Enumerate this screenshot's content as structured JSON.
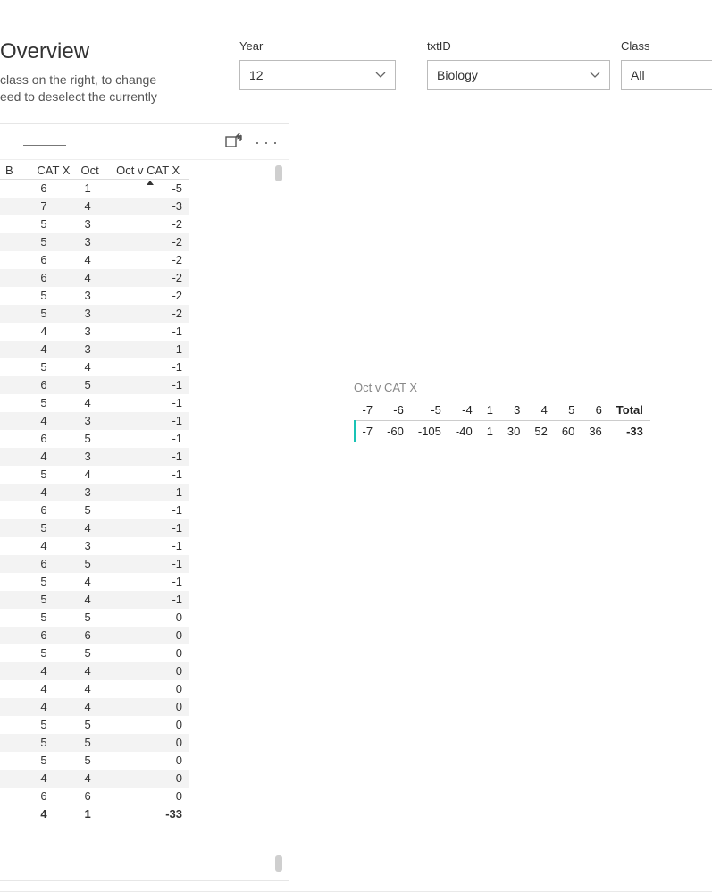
{
  "header": {
    "title": "Overview",
    "subtitle_line1": "class on the right, to change",
    "subtitle_line2": "eed to deselect the currently"
  },
  "slicers": {
    "year": {
      "label": "Year",
      "value": "12"
    },
    "txtid": {
      "label": "txtID",
      "value": "Biology"
    },
    "class": {
      "label": "Class",
      "value": "All"
    }
  },
  "left_table": {
    "columns": {
      "b": "B",
      "catx": "CAT X",
      "oct": "Oct",
      "delta": "Oct v CAT X"
    },
    "sort_column": "delta",
    "rows": [
      {
        "b": "",
        "catx": "6",
        "oct": "1",
        "delta": "-5"
      },
      {
        "b": "",
        "catx": "7",
        "oct": "4",
        "delta": "-3"
      },
      {
        "b": "",
        "catx": "5",
        "oct": "3",
        "delta": "-2"
      },
      {
        "b": "",
        "catx": "5",
        "oct": "3",
        "delta": "-2"
      },
      {
        "b": "",
        "catx": "6",
        "oct": "4",
        "delta": "-2"
      },
      {
        "b": "",
        "catx": "6",
        "oct": "4",
        "delta": "-2"
      },
      {
        "b": "",
        "catx": "5",
        "oct": "3",
        "delta": "-2"
      },
      {
        "b": "",
        "catx": "5",
        "oct": "3",
        "delta": "-2"
      },
      {
        "b": "",
        "catx": "4",
        "oct": "3",
        "delta": "-1"
      },
      {
        "b": "",
        "catx": "4",
        "oct": "3",
        "delta": "-1"
      },
      {
        "b": "",
        "catx": "5",
        "oct": "4",
        "delta": "-1"
      },
      {
        "b": "",
        "catx": "6",
        "oct": "5",
        "delta": "-1"
      },
      {
        "b": "",
        "catx": "5",
        "oct": "4",
        "delta": "-1"
      },
      {
        "b": "",
        "catx": "4",
        "oct": "3",
        "delta": "-1"
      },
      {
        "b": "",
        "catx": "6",
        "oct": "5",
        "delta": "-1"
      },
      {
        "b": "",
        "catx": "4",
        "oct": "3",
        "delta": "-1"
      },
      {
        "b": "",
        "catx": "5",
        "oct": "4",
        "delta": "-1"
      },
      {
        "b": "",
        "catx": "4",
        "oct": "3",
        "delta": "-1"
      },
      {
        "b": "",
        "catx": "6",
        "oct": "5",
        "delta": "-1"
      },
      {
        "b": "",
        "catx": "5",
        "oct": "4",
        "delta": "-1"
      },
      {
        "b": "",
        "catx": "4",
        "oct": "3",
        "delta": "-1"
      },
      {
        "b": "",
        "catx": "6",
        "oct": "5",
        "delta": "-1"
      },
      {
        "b": "",
        "catx": "5",
        "oct": "4",
        "delta": "-1"
      },
      {
        "b": "",
        "catx": "5",
        "oct": "4",
        "delta": "-1"
      },
      {
        "b": "",
        "catx": "5",
        "oct": "5",
        "delta": "0"
      },
      {
        "b": "",
        "catx": "6",
        "oct": "6",
        "delta": "0"
      },
      {
        "b": "",
        "catx": "5",
        "oct": "5",
        "delta": "0"
      },
      {
        "b": "",
        "catx": "4",
        "oct": "4",
        "delta": "0"
      },
      {
        "b": "",
        "catx": "4",
        "oct": "4",
        "delta": "0"
      },
      {
        "b": "",
        "catx": "4",
        "oct": "4",
        "delta": "0"
      },
      {
        "b": "",
        "catx": "5",
        "oct": "5",
        "delta": "0"
      },
      {
        "b": "",
        "catx": "5",
        "oct": "5",
        "delta": "0"
      },
      {
        "b": "",
        "catx": "5",
        "oct": "5",
        "delta": "0"
      },
      {
        "b": "",
        "catx": "4",
        "oct": "4",
        "delta": "0"
      },
      {
        "b": "",
        "catx": "6",
        "oct": "6",
        "delta": "0"
      }
    ],
    "total": {
      "catx": "4",
      "oct": "1",
      "delta": "-33"
    }
  },
  "pivot": {
    "title": "Oct v CAT X",
    "headers": [
      "-7",
      "-6",
      "-5",
      "-4",
      "1",
      "3",
      "4",
      "5",
      "6",
      "Total"
    ],
    "values": [
      "-7",
      "-60",
      "-105",
      "-40",
      "1",
      "30",
      "52",
      "60",
      "36",
      "-33"
    ]
  },
  "chart_data": {
    "type": "table",
    "title": "Oct v CAT X",
    "columns": [
      "-7",
      "-6",
      "-5",
      "-4",
      "1",
      "3",
      "4",
      "5",
      "6",
      "Total"
    ],
    "rows": [
      [
        -7,
        -60,
        -105,
        -40,
        1,
        30,
        52,
        60,
        36,
        -33
      ]
    ]
  }
}
